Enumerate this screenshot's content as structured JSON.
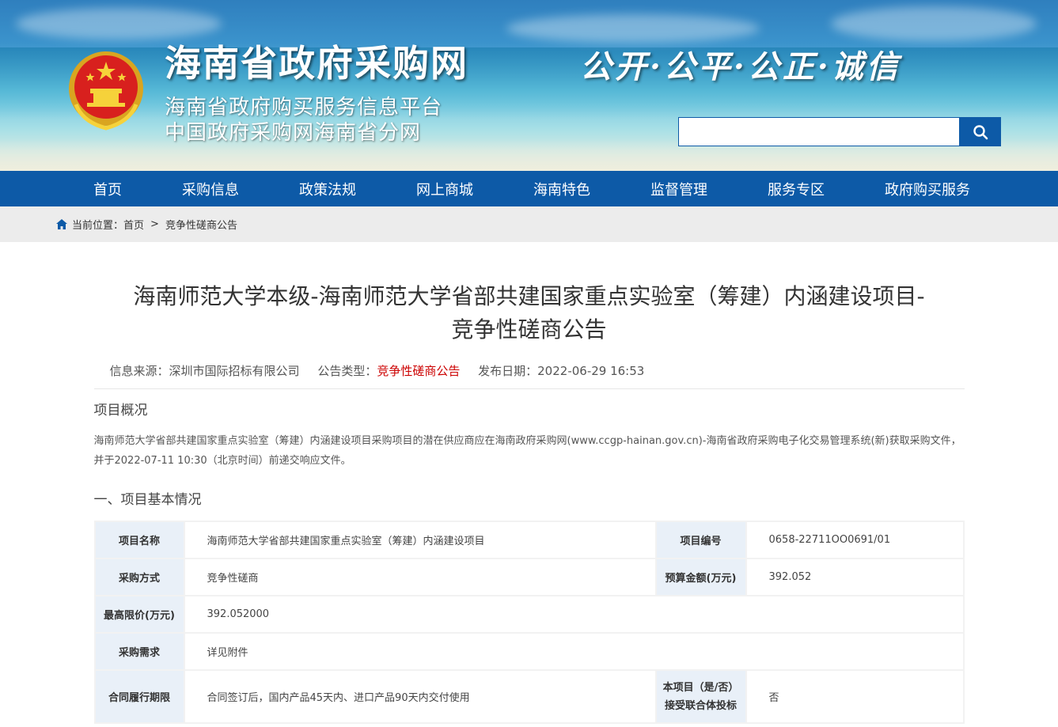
{
  "header": {
    "site_title": "海南省政府采购网",
    "subtitle_1": "海南省政府购买服务信息平台",
    "subtitle_2": "中国政府采购网海南省分网",
    "slogan": "公开·公平·公正·诚信",
    "search_placeholder": "",
    "emblem_icon": "national-emblem-icon",
    "search_icon": "search-icon",
    "brand_color": "#0d5aa7"
  },
  "nav": {
    "items": [
      "首页",
      "采购信息",
      "政策法规",
      "网上商城",
      "海南特色",
      "监督管理",
      "服务专区",
      "政府购买服务"
    ]
  },
  "breadcrumb": {
    "prefix": "当前位置：",
    "home": "首页",
    "separator": ">",
    "current": "竞争性磋商公告"
  },
  "article": {
    "title_line1": "海南师范大学本级-海南师范大学省部共建国家重点实验室（筹建）内涵建设项目-",
    "title_line2": "竞争性磋商公告",
    "source_label": "信息来源：",
    "source_value": "深圳市国际招标有限公司",
    "type_label": "公告类型：",
    "type_value": "竞争性磋商公告",
    "date_label": "发布日期：",
    "date_value": "2022-06-29 16:53",
    "overview_heading": "项目概况",
    "overview_text": "海南师范大学省部共建国家重点实验室（筹建）内涵建设项目采购项目的潜在供应商应在海南政府采购网(www.ccgp-hainan.gov.cn)-海南省政府采购电子化交易管理系统(新)获取采购文件，并于2022-07-11 10:30（北京时间）前递交响应文件。",
    "section1_heading": "一、项目基本情况"
  },
  "table": {
    "project_name_label": "项目名称",
    "project_name_value": "海南师范大学省部共建国家重点实验室（筹建）内涵建设项目",
    "project_no_label": "项目编号",
    "project_no_value": "0658-22711OO0691/01",
    "method_label": "采购方式",
    "method_value": "竞争性磋商",
    "budget_label": "预算金额(万元)",
    "budget_value": "392.052",
    "max_price_label": "最高限价(万元)",
    "max_price_value": "392.052000",
    "requirement_label": "采购需求",
    "requirement_value": "详见附件",
    "period_label": "合同履行期限",
    "period_value": "合同签订后，国内产品45天内、进口产品90天内交付使用",
    "consortium_label_1": "本项目（是/否）",
    "consortium_label_2": "接受联合体投标",
    "consortium_value": "否"
  }
}
